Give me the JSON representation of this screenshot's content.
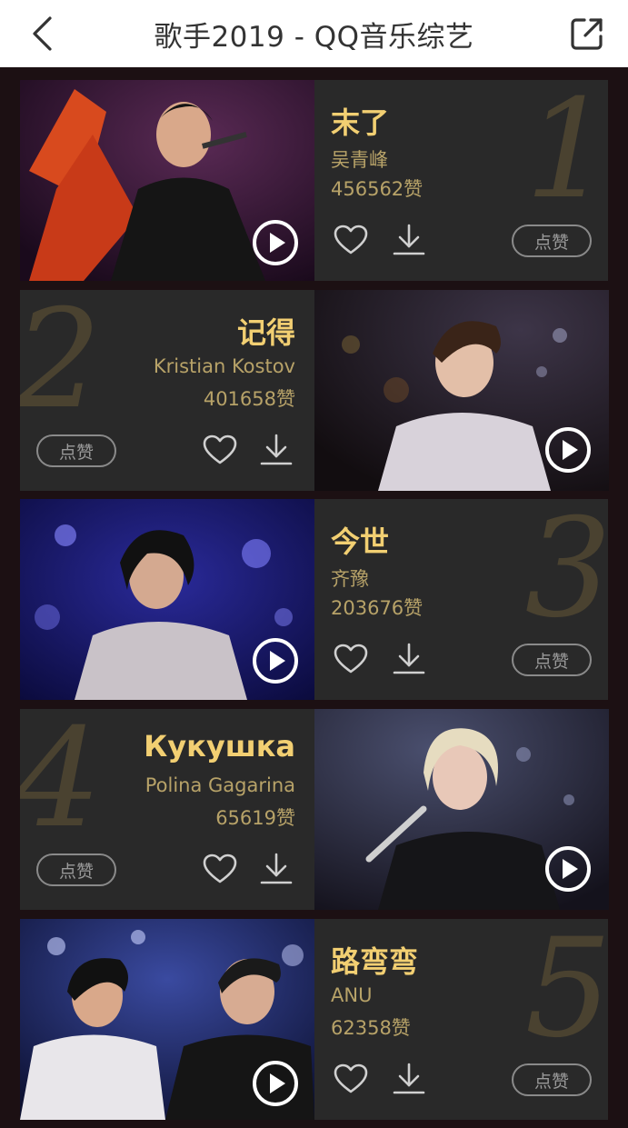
{
  "header": {
    "title": "歌手2019 - QQ音乐综艺",
    "back_icon": "chevron-left-icon",
    "share_icon": "share-external-icon"
  },
  "colors": {
    "accent": "#f2cf72",
    "secondary_text": "#b7a268",
    "card_bg": "#292929",
    "page_bg": "#1c1013",
    "rank_numeral": "#4a4230"
  },
  "songs": [
    {
      "rank": "1",
      "title": "末了",
      "artist": "吴青峰",
      "likes": "456562赞",
      "vote_label": "点赞",
      "layout": "photo-left"
    },
    {
      "rank": "2",
      "title": "记得",
      "artist": "Kristian Kostov",
      "likes": "401658赞",
      "vote_label": "点赞",
      "layout": "photo-right"
    },
    {
      "rank": "3",
      "title": "今世",
      "artist": "齐豫",
      "likes": "203676赞",
      "vote_label": "点赞",
      "layout": "photo-left"
    },
    {
      "rank": "4",
      "title": "Кукушка",
      "artist": "Polina Gagarina",
      "likes": "65619赞",
      "vote_label": "点赞",
      "layout": "photo-right"
    },
    {
      "rank": "5",
      "title": "路弯弯",
      "artist": "ANU",
      "likes": "62358赞",
      "vote_label": "点赞",
      "layout": "photo-left"
    }
  ]
}
